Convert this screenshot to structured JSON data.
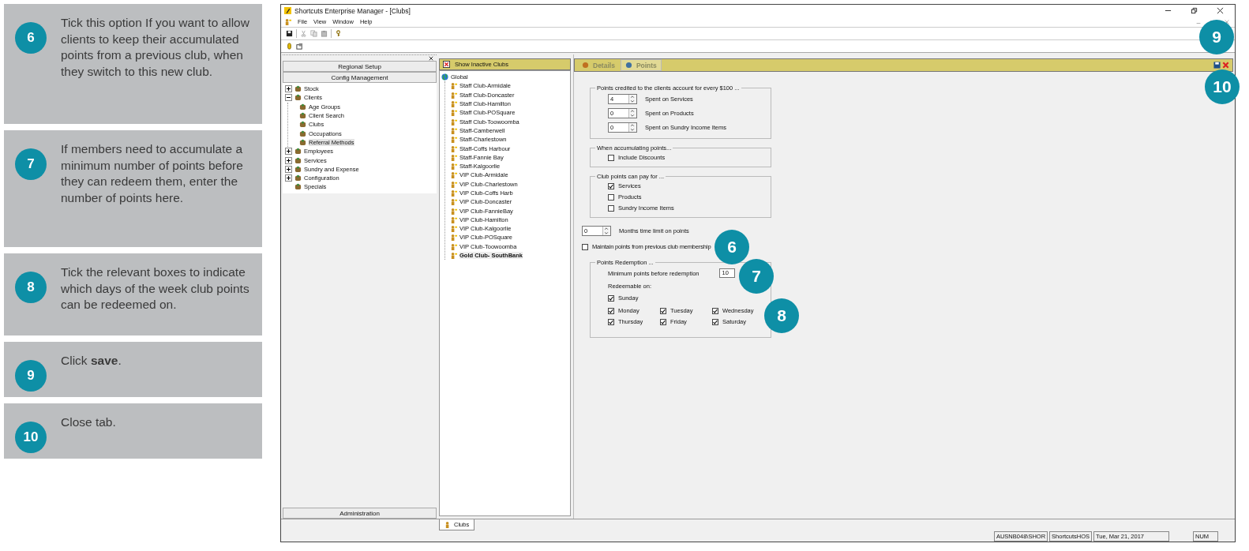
{
  "steps": [
    {
      "number": "6",
      "text": "Tick this option If you want to allow clients to keep their accumulated points from a previous club, when they switch to this new club."
    },
    {
      "number": "7",
      "text": "If members need to accumulate a minimum number of points before they can redeem them, enter the number of points here."
    },
    {
      "number": "8",
      "text": "Tick the relevant boxes to indicate which days of the week club points can be redeemed on."
    },
    {
      "number": "9",
      "text": "Click **save**."
    },
    {
      "number": "10",
      "text": "Close tab."
    }
  ],
  "window": {
    "title": "Shortcuts Enterprise Manager - [Clubs]"
  },
  "menu": [
    "File",
    "View",
    "Window",
    "Help"
  ],
  "nav_buttons": [
    "Regional Setup",
    "Config Management"
  ],
  "tree": [
    {
      "label": "Stock",
      "expanded": false
    },
    {
      "label": "Clients",
      "expanded": true,
      "children": [
        {
          "label": "Age Groups",
          "selected": false
        },
        {
          "label": "Client Search",
          "selected": false
        },
        {
          "label": "Clubs",
          "selected": false
        },
        {
          "label": "Occupations",
          "selected": false
        },
        {
          "label": "Referral Methods",
          "selected": true
        }
      ]
    },
    {
      "label": "Employees",
      "expanded": false
    },
    {
      "label": "Services",
      "expanded": false
    },
    {
      "label": "Sundry and Expense",
      "expanded": false
    },
    {
      "label": "Configuration",
      "expanded": false
    },
    {
      "label": "Specials"
    }
  ],
  "footer_button": "Administration",
  "clubs": {
    "toggle": "Show Inactive Clubs",
    "root": "Global",
    "items": [
      {
        "label": "Staff Club-Armidale",
        "selected": false
      },
      {
        "label": "Staff Club-Doncaster",
        "selected": false
      },
      {
        "label": "Staff Club-Hamilton",
        "selected": false
      },
      {
        "label": "Staff Club-POSquare",
        "selected": false
      },
      {
        "label": "Staff Club-Toowoomba",
        "selected": false
      },
      {
        "label": "Staff-Camberwell",
        "selected": false
      },
      {
        "label": "Staff-Charlestown",
        "selected": false
      },
      {
        "label": "Staff-Coffs Harbour",
        "selected": false
      },
      {
        "label": "Staff-Fannie Bay",
        "selected": false
      },
      {
        "label": "Staff-Kalgoorlie",
        "selected": false
      },
      {
        "label": "VIP Club-Armidale",
        "selected": false
      },
      {
        "label": "VIP Club-Charlestown",
        "selected": false
      },
      {
        "label": "VIP Club-Coffs Harb",
        "selected": false
      },
      {
        "label": "VIP Club-Doncaster",
        "selected": false
      },
      {
        "label": "VIP Club-FannieBay",
        "selected": false
      },
      {
        "label": "VIP Club-Hamilton",
        "selected": false
      },
      {
        "label": "VIP Club-Kalgoorlie",
        "selected": false
      },
      {
        "label": "VIP Club-POSquare",
        "selected": false
      },
      {
        "label": "VIP Club-Toowoomba",
        "selected": false
      },
      {
        "label": "Gold Club- SouthBank",
        "selected": true
      }
    ]
  },
  "tabs": [
    {
      "label": "Details",
      "selected": false
    },
    {
      "label": "Points",
      "selected": true
    }
  ],
  "points_credit": {
    "legend": "Points credited to the clients account for every $100 ...",
    "rows": [
      {
        "value": "4",
        "label": "Spent on Services"
      },
      {
        "value": "0",
        "label": "Spent on Products"
      },
      {
        "value": "0",
        "label": "Spent on Sundry Income Items"
      }
    ]
  },
  "accumulating": {
    "legend": "When accumulating points...",
    "options": [
      {
        "label": "Include Discounts",
        "checked": false
      }
    ]
  },
  "pay_for": {
    "legend": "Club points can pay for ...",
    "options": [
      {
        "label": "Services",
        "checked": true
      },
      {
        "label": "Products",
        "checked": false
      },
      {
        "label": "Sundry Income Items",
        "checked": false
      }
    ]
  },
  "months": {
    "value": "0",
    "label": "Months time limit on points"
  },
  "maintain": {
    "label": "Maintain points from previous club membership",
    "checked": false
  },
  "redemption": {
    "legend": "Points Redemption ...",
    "min_label": "Minimum points before redemption",
    "min_value": "10",
    "redeemable_label": "Redeemable on:",
    "days": [
      {
        "label": "Sunday",
        "checked": true
      },
      {
        "label": "Monday",
        "checked": true
      },
      {
        "label": "Tuesday",
        "checked": true
      },
      {
        "label": "Wednesday",
        "checked": true
      },
      {
        "label": "Thursday",
        "checked": true
      },
      {
        "label": "Friday",
        "checked": true
      },
      {
        "label": "Saturday",
        "checked": true
      }
    ]
  },
  "bottom_tabs": [
    {
      "label": "Clubs",
      "selected": true
    }
  ],
  "status_bar": [
    "AUSNB048\\SHOR",
    "ShortcutsHOS",
    "Tue, Mar 21, 2017",
    "NUM"
  ],
  "callouts": [
    "6",
    "7",
    "8",
    "9",
    "10"
  ]
}
